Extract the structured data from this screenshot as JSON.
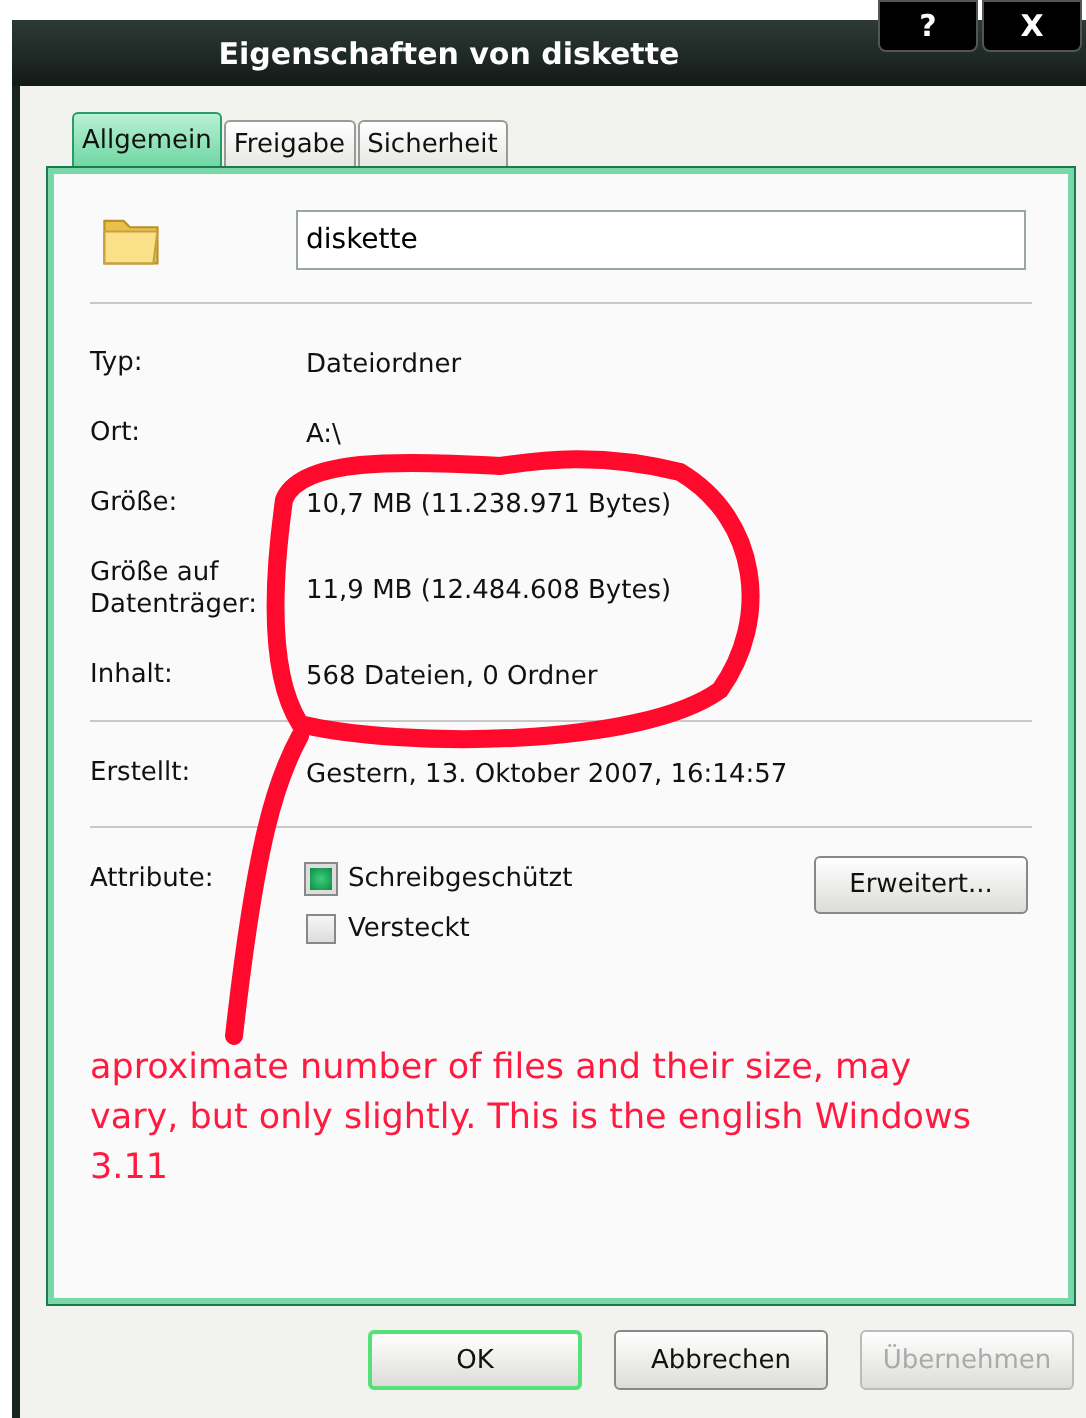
{
  "window": {
    "title": "Eigenschaften von diskette",
    "controls": [
      "?",
      "X"
    ]
  },
  "tabs": [
    {
      "label": "Allgemein",
      "selected": true
    },
    {
      "label": "Freigabe",
      "selected": false
    },
    {
      "label": "Sicherheit",
      "selected": false
    }
  ],
  "name_field": {
    "value": "diskette"
  },
  "properties": [
    {
      "label": "Typ:",
      "value": "Dateiordner"
    },
    {
      "label": "Ort:",
      "value": "A:\\"
    },
    {
      "label": "Größe:",
      "value": "10,7 MB (11.238.971 Bytes)"
    },
    {
      "label": "Größe auf Datenträger:",
      "value": "11,9 MB (12.484.608 Bytes)"
    },
    {
      "label": "Inhalt:",
      "value": "568 Dateien, 0 Ordner"
    }
  ],
  "created": {
    "label": "Erstellt:",
    "value": "Gestern, 13. Oktober 2007, 16:14:57"
  },
  "attributes": {
    "label": "Attribute:",
    "items": [
      {
        "label": "Schreibgeschützt",
        "checked": true
      },
      {
        "label": "Versteckt",
        "checked": false
      }
    ],
    "button": "Erweitert..."
  },
  "annotation": {
    "text": "aproximate number of files and their size, may vary, but only slightly. This is the english Windows 3.11"
  },
  "buttons": [
    {
      "label": "OK",
      "disabled": false,
      "default": true
    },
    {
      "label": "Abbrechen",
      "disabled": false,
      "default": false
    },
    {
      "label": "Übernehmen",
      "disabled": true,
      "default": false
    }
  ]
}
